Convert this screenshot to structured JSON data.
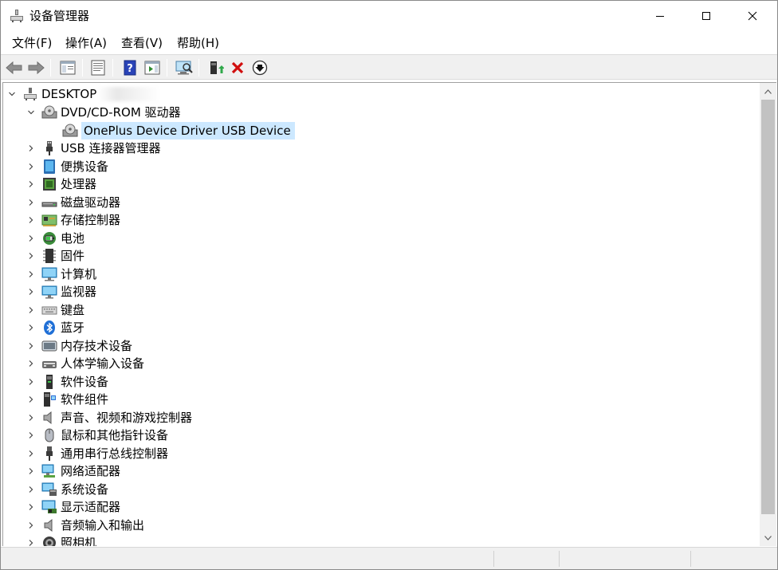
{
  "window": {
    "title": "设备管理器"
  },
  "menu": [
    {
      "label": "文件(F)"
    },
    {
      "label": "操作(A)"
    },
    {
      "label": "查看(V)"
    },
    {
      "label": "帮助(H)"
    }
  ],
  "toolbar": {
    "icons": [
      "back-arrow-icon",
      "forward-arrow-icon",
      "show-hide-console-tree-icon",
      "properties-sheet-icon",
      "help-icon",
      "action-pane-icon",
      "scan-hardware-icon",
      "update-driver-icon",
      "uninstall-device-icon",
      "disable-device-icon"
    ]
  },
  "tree": {
    "root": {
      "label": "DESKTOP"
    },
    "dvd": {
      "label": "DVD/CD-ROM 驱动器",
      "child": "OnePlus Device Driver USB Device"
    },
    "categories": [
      {
        "label": "USB 连接器管理器",
        "icon": "usb-connector-icon"
      },
      {
        "label": "便携设备",
        "icon": "portable-device-icon"
      },
      {
        "label": "处理器",
        "icon": "processor-icon"
      },
      {
        "label": "磁盘驱动器",
        "icon": "disk-drive-icon"
      },
      {
        "label": "存储控制器",
        "icon": "storage-controller-icon"
      },
      {
        "label": "电池",
        "icon": "battery-icon"
      },
      {
        "label": "固件",
        "icon": "firmware-icon"
      },
      {
        "label": "计算机",
        "icon": "computer-icon"
      },
      {
        "label": "监视器",
        "icon": "monitor-icon"
      },
      {
        "label": "键盘",
        "icon": "keyboard-icon"
      },
      {
        "label": "蓝牙",
        "icon": "bluetooth-icon"
      },
      {
        "label": "内存技术设备",
        "icon": "memory-device-icon"
      },
      {
        "label": "人体学输入设备",
        "icon": "hid-icon"
      },
      {
        "label": "软件设备",
        "icon": "software-device-icon"
      },
      {
        "label": "软件组件",
        "icon": "software-component-icon"
      },
      {
        "label": "声音、视频和游戏控制器",
        "icon": "speaker-icon"
      },
      {
        "label": "鼠标和其他指针设备",
        "icon": "mouse-icon"
      },
      {
        "label": "通用串行总线控制器",
        "icon": "usb-controller-icon"
      },
      {
        "label": "网络适配器",
        "icon": "network-adapter-icon"
      },
      {
        "label": "系统设备",
        "icon": "system-device-icon"
      },
      {
        "label": "显示适配器",
        "icon": "display-adapter-icon"
      },
      {
        "label": "音频输入和输出",
        "icon": "audio-io-icon"
      },
      {
        "label": "照相机",
        "icon": "camera-icon"
      }
    ]
  },
  "colors": {
    "selection": "#cce8ff",
    "accent": "#1e6fd9"
  }
}
